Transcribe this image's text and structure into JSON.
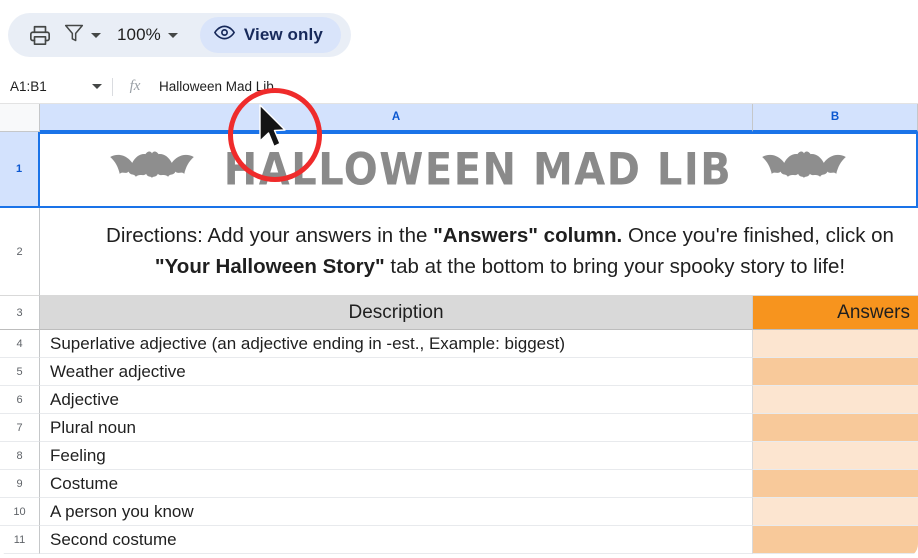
{
  "toolbar": {
    "print_icon": "print-icon",
    "filter_icon": "filter-funnel-icon",
    "filter_caret": "chevron-down-icon",
    "zoom_level": "100%",
    "zoom_caret": "chevron-down-icon",
    "view_only_label": "View only",
    "view_only_icon": "eye-icon",
    "pill_bg": "#E9EEF6",
    "view_only_bg": "#D9E4FA",
    "view_only_color": "#17295A"
  },
  "formula_bar": {
    "name_box_value": "A1:B1",
    "name_box_caret": "chevron-down-icon",
    "fx_label": "fx",
    "formula_value": "Halloween Mad Lib"
  },
  "grid": {
    "columns": [
      {
        "label": "A",
        "selected": true
      },
      {
        "label": "B",
        "selected": true
      }
    ],
    "selection_color": "#1a73e8",
    "header_selected_bg": "#D3E2FD",
    "title_row": {
      "row_number": "1",
      "title": "HALLOWEEN MAD LIB",
      "title_color": "#8a8a8a",
      "bat_left": "bat-icon",
      "bat_right": "bat-icon"
    },
    "directions_row": {
      "row_number": "2",
      "line1_part1": "Directions: Add your answers in the ",
      "line1_bold": "\"Answers\" column.",
      "line1_part2": " Once you're finished, click on",
      "line2_bold": "\"Your Halloween Story\"",
      "line2_part2": " tab at the bottom to bring your spooky story to life!"
    },
    "header_row": {
      "row_number": "3",
      "description_label": "Description",
      "answers_label": "Answers",
      "description_bg": "#d9d9d9",
      "answers_bg": "#F7941E"
    },
    "rows": [
      {
        "num": "4",
        "description": "Superlative adjective (an adjective ending in -est., Example: biggest)",
        "shade": "light"
      },
      {
        "num": "5",
        "description": "Weather adjective",
        "shade": "dark"
      },
      {
        "num": "6",
        "description": "Adjective",
        "shade": "light"
      },
      {
        "num": "7",
        "description": "Plural noun",
        "shade": "dark"
      },
      {
        "num": "8",
        "description": "Feeling",
        "shade": "light"
      },
      {
        "num": "9",
        "description": "Costume",
        "shade": "dark"
      },
      {
        "num": "10",
        "description": "A person you know",
        "shade": "light"
      },
      {
        "num": "11",
        "description": "Second costume",
        "shade": "dark"
      }
    ],
    "answer_light_bg": "#FCE5D0",
    "answer_dark_bg": "#F8C99A"
  },
  "annotation": {
    "circle_color": "#ef2b2b",
    "cursor": "mouse-pointer-icon"
  }
}
